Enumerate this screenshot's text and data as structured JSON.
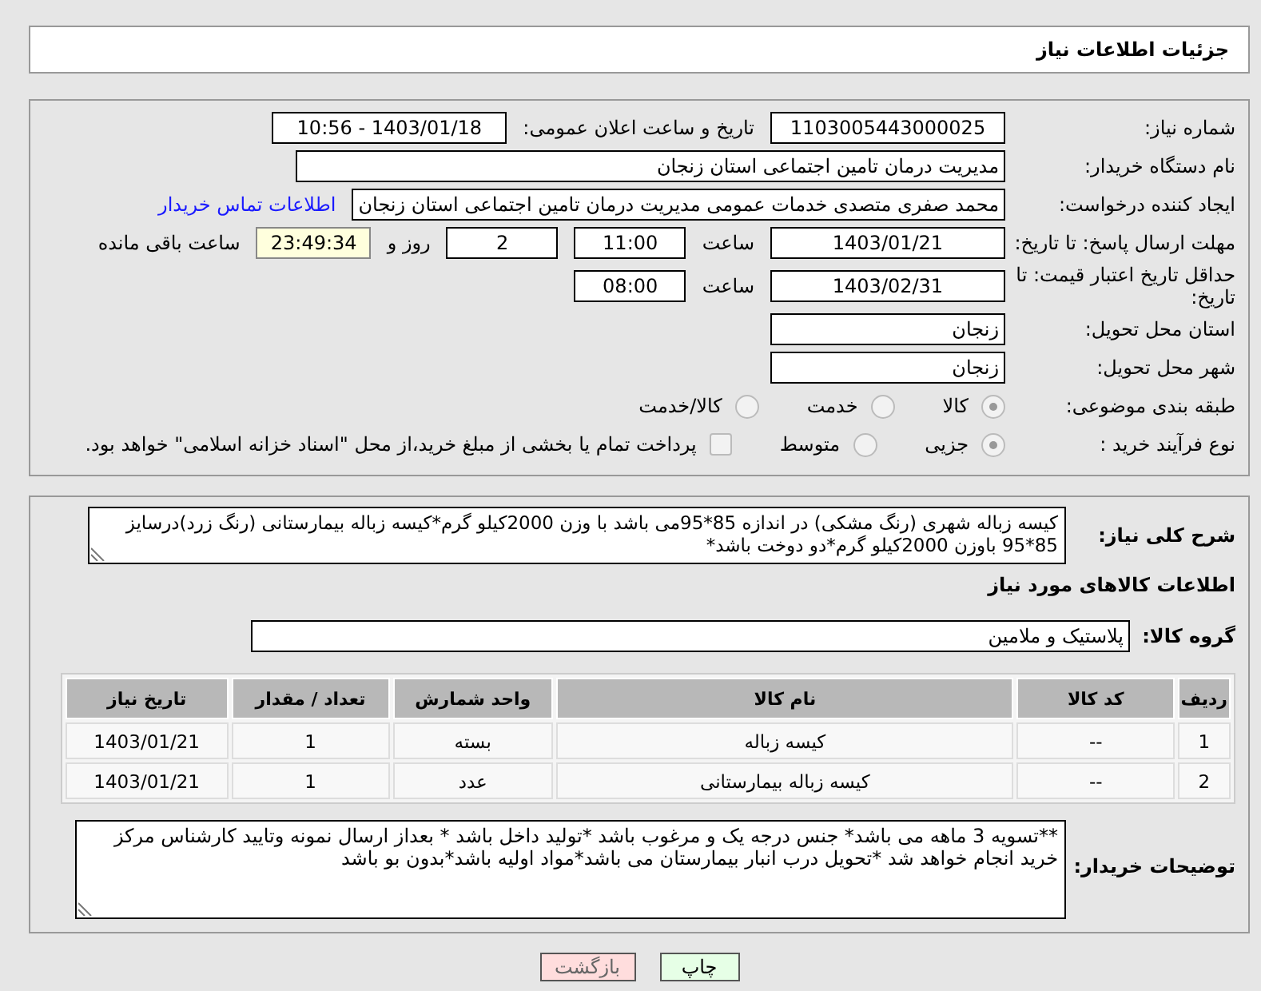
{
  "header": {
    "title": "جزئیات اطلاعات نیاز"
  },
  "details": [
    {
      "label": "شماره نیاز:",
      "items": [
        {
          "kind": "field",
          "text": "1103005443000025"
        },
        {
          "kind": "label",
          "text": "تاریخ و ساعت اعلان عمومی:"
        },
        {
          "kind": "field",
          "text": "1403/01/18 - 10:56"
        }
      ]
    },
    {
      "label": "نام دستگاه خریدار:",
      "items": [
        {
          "kind": "long_field",
          "text": "مدیریت درمان تامین اجتماعی استان زنجان"
        }
      ]
    },
    {
      "label": "ایجاد کننده درخواست:",
      "items": [
        {
          "kind": "text_field",
          "text": "محمد صفری متصدی خدمات عمومی مدیریت درمان تامین اجتماعی استان زنجان"
        },
        {
          "kind": "link",
          "text": "اطلاعات تماس خریدار"
        }
      ]
    },
    {
      "label": "مهلت ارسال پاسخ: تا تاریخ:",
      "items": [
        {
          "kind": "field",
          "text": "1403/01/21"
        },
        {
          "kind": "label",
          "text": "ساعت"
        },
        {
          "kind": "small_field",
          "text": "11:00"
        },
        {
          "kind": "small_field",
          "text": "2"
        },
        {
          "kind": "label",
          "text": "روز و"
        },
        {
          "kind": "timer",
          "text": "23:49:34"
        },
        {
          "kind": "label",
          "text": "ساعت باقی مانده"
        }
      ]
    },
    {
      "label": "حداقل تاریخ اعتبار قیمت: تا تاریخ:",
      "items": [
        {
          "kind": "field",
          "text": "1403/02/31"
        },
        {
          "kind": "label",
          "text": "ساعت"
        },
        {
          "kind": "small_field",
          "text": "08:00"
        }
      ]
    },
    {
      "label": "استان محل تحویل:",
      "items": [
        {
          "kind": "text_field",
          "text": "زنجان"
        }
      ]
    },
    {
      "label": "شهر محل تحویل:",
      "items": [
        {
          "kind": "text_field",
          "text": "زنجان"
        }
      ]
    },
    {
      "label": "طبقه بندی موضوعی:",
      "items": [
        {
          "kind": "radio",
          "text": "کالا",
          "selected": true
        },
        {
          "kind": "radio",
          "text": "خدمت",
          "selected": false
        },
        {
          "kind": "radio",
          "text": "کالا/خدمت",
          "selected": false
        }
      ]
    },
    {
      "label": "نوع فرآیند خرید :",
      "items": [
        {
          "kind": "radio",
          "text": "جزیی",
          "selected": true
        },
        {
          "kind": "radio",
          "text": "متوسط",
          "selected": false
        },
        {
          "kind": "checkbox",
          "text": "پرداخت تمام یا بخشی از مبلغ خرید،از محل \"اسناد خزانه اسلامی\" خواهد بود.",
          "checked": false
        }
      ]
    }
  ],
  "description": {
    "label": "شرح کلی نیاز:",
    "text": "کیسه زباله شهری (رنگ مشکی) در اندازه 85*95می باشد با وزن 2000کیلو گرم*کیسه زباله بیمارستانی (رنگ زرد)درسایز 85*95 باوزن 2000کیلو گرم*دو دوخت باشد*"
  },
  "goods_heading": "اطلاعات کالاهای مورد نیاز",
  "goods_group": {
    "label": "گروه کالا:",
    "value": "پلاستیک و ملامین"
  },
  "table": {
    "columns": [
      "ردیف",
      "کد کالا",
      "نام کالا",
      "واحد شمارش",
      "تعداد / مقدار",
      "تاریخ نیاز"
    ],
    "rows": [
      [
        "1",
        "--",
        "کیسه زباله",
        "بسته",
        "1",
        "1403/01/21"
      ],
      [
        "2",
        "--",
        "کیسه زباله بیمارستانی",
        "عدد",
        "1",
        "1403/01/21"
      ]
    ]
  },
  "buyer_notes": {
    "label": "توضیحات خریدار:",
    "text": "**تسویه 3 ماهه می باشد* جنس درجه یک و مرغوب باشد *تولید داخل باشد * بعداز ارسال نمونه وتایید کارشناس مرکز خرید انجام خواهد شد *تحویل درب انبار بیمارستان می باشد*مواد اولیه باشد*بدون بو باشد"
  },
  "buttons": [
    {
      "kind": "print",
      "label": "چاپ"
    },
    {
      "kind": "back",
      "label": "بازگشت"
    }
  ]
}
